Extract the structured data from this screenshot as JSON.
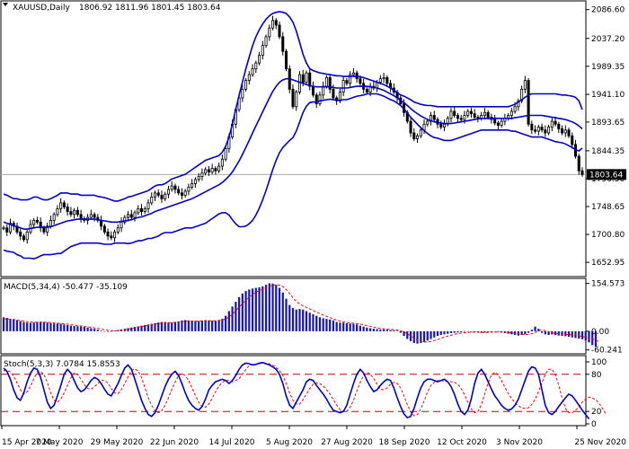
{
  "chart_data": [
    {
      "type": "candlestick",
      "symbol": "XAUUSD,Daily",
      "ohlc_label": "1806.92 1811.96 1801.45 1803.64",
      "current_price": 1803.64,
      "current_price_label": "1803.64",
      "ylim": [
        1630,
        2100
      ],
      "y_ticks": [
        "2086.60",
        "2037.20",
        "1989.35",
        "1941.10",
        "1893.65",
        "1844.35",
        "1796.50",
        "1748.65",
        "1700.80",
        "1652.95"
      ],
      "close_series": [
        1712,
        1705,
        1720,
        1715,
        1705,
        1698,
        1692,
        1705,
        1718,
        1725,
        1722,
        1712,
        1705,
        1715,
        1725,
        1735,
        1745,
        1755,
        1748,
        1740,
        1735,
        1742,
        1735,
        1728,
        1725,
        1730,
        1735,
        1730,
        1725,
        1715,
        1705,
        1698,
        1695,
        1705,
        1712,
        1722,
        1730,
        1735,
        1730,
        1738,
        1745,
        1740,
        1745,
        1755,
        1765,
        1772,
        1768,
        1762,
        1770,
        1778,
        1784,
        1778,
        1772,
        1768,
        1775,
        1782,
        1788,
        1795,
        1800,
        1806,
        1812,
        1808,
        1814,
        1810,
        1818,
        1830,
        1848,
        1868,
        1890,
        1915,
        1935,
        1950,
        1965,
        1975,
        1985,
        1995,
        2008,
        2025,
        2040,
        2055,
        2068,
        2060,
        2040,
        2015,
        1985,
        1950,
        1920,
        1945,
        1975,
        1962,
        1978,
        1955,
        1940,
        1925,
        1940,
        1955,
        1970,
        1950,
        1935,
        1930,
        1945,
        1965,
        1960,
        1975,
        1978,
        1968,
        1960,
        1950,
        1945,
        1955,
        1952,
        1962,
        1968,
        1970,
        1960,
        1952,
        1945,
        1935,
        1925,
        1910,
        1895,
        1875,
        1865,
        1870,
        1880,
        1890,
        1895,
        1905,
        1898,
        1890,
        1885,
        1890,
        1900,
        1912,
        1905,
        1900,
        1898,
        1905,
        1912,
        1908,
        1902,
        1900,
        1905,
        1910,
        1902,
        1898,
        1892,
        1888,
        1895,
        1900,
        1905,
        1912,
        1920,
        1930,
        1950,
        1965,
        1890,
        1880,
        1878,
        1885,
        1880,
        1875,
        1885,
        1895,
        1890,
        1882,
        1875,
        1880,
        1870,
        1855,
        1835,
        1810,
        1803.64
      ],
      "bollinger_upper": [
        1770,
        1768,
        1765,
        1762,
        1762,
        1760,
        1760,
        1760,
        1762,
        1765,
        1765,
        1762,
        1760,
        1760,
        1762,
        1765,
        1768,
        1772,
        1772,
        1772,
        1770,
        1770,
        1770,
        1768,
        1768,
        1768,
        1768,
        1768,
        1766,
        1765,
        1764,
        1762,
        1760,
        1758,
        1758,
        1760,
        1762,
        1765,
        1766,
        1768,
        1770,
        1772,
        1774,
        1776,
        1780,
        1784,
        1786,
        1786,
        1788,
        1792,
        1796,
        1798,
        1800,
        1802,
        1804,
        1808,
        1812,
        1816,
        1820,
        1824,
        1828,
        1830,
        1832,
        1834,
        1836,
        1842,
        1852,
        1868,
        1890,
        1915,
        1940,
        1962,
        1985,
        2005,
        2025,
        2040,
        2052,
        2062,
        2070,
        2076,
        2080,
        2082,
        2083,
        2082,
        2080,
        2074,
        2065,
        2050,
        2030,
        2010,
        1995,
        1985,
        1982,
        1980,
        1978,
        1977,
        1976,
        1975,
        1974,
        1973,
        1973,
        1972,
        1972,
        1972,
        1972,
        1972,
        1971,
        1970,
        1968,
        1966,
        1964,
        1962,
        1960,
        1958,
        1955,
        1952,
        1948,
        1944,
        1940,
        1938,
        1935,
        1932,
        1928,
        1926,
        1924,
        1923,
        1922,
        1922,
        1921,
        1920,
        1920,
        1920,
        1920,
        1920,
        1920,
        1920,
        1920,
        1920,
        1920,
        1920,
        1920,
        1920,
        1920,
        1920,
        1920,
        1920,
        1920,
        1920,
        1920,
        1920,
        1920,
        1922,
        1924,
        1928,
        1932,
        1936,
        1940,
        1942,
        1942,
        1942,
        1942,
        1942,
        1942,
        1942,
        1942,
        1941,
        1940,
        1940,
        1939,
        1938,
        1936,
        1930,
        1915
      ],
      "bollinger_middle": [
        1722,
        1720,
        1718,
        1716,
        1714,
        1712,
        1710,
        1710,
        1711,
        1712,
        1713,
        1713,
        1713,
        1713,
        1714,
        1716,
        1718,
        1720,
        1722,
        1724,
        1725,
        1726,
        1727,
        1727,
        1727,
        1727,
        1727,
        1727,
        1726,
        1725,
        1724,
        1723,
        1722,
        1722,
        1722,
        1723,
        1724,
        1725,
        1726,
        1728,
        1730,
        1731,
        1733,
        1735,
        1737,
        1740,
        1742,
        1744,
        1746,
        1748,
        1750,
        1752,
        1754,
        1756,
        1758,
        1760,
        1762,
        1765,
        1768,
        1771,
        1774,
        1777,
        1780,
        1783,
        1786,
        1790,
        1795,
        1801,
        1808,
        1817,
        1827,
        1838,
        1850,
        1862,
        1875,
        1887,
        1899,
        1911,
        1923,
        1935,
        1946,
        1955,
        1962,
        1966,
        1968,
        1968,
        1966,
        1964,
        1962,
        1960,
        1958,
        1956,
        1955,
        1954,
        1954,
        1954,
        1954,
        1954,
        1953,
        1952,
        1952,
        1952,
        1952,
        1953,
        1954,
        1955,
        1955,
        1955,
        1955,
        1954,
        1953,
        1952,
        1950,
        1948,
        1945,
        1942,
        1939,
        1935,
        1931,
        1927,
        1922,
        1917,
        1912,
        1908,
        1904,
        1901,
        1898,
        1896,
        1894,
        1893,
        1892,
        1891,
        1891,
        1891,
        1892,
        1893,
        1894,
        1895,
        1896,
        1897,
        1898,
        1899,
        1900,
        1900,
        1900,
        1900,
        1900,
        1900,
        1900,
        1900,
        1900,
        1900,
        1901,
        1902,
        1903,
        1904,
        1905,
        1905,
        1905,
        1905,
        1905,
        1904,
        1903,
        1902,
        1901,
        1900,
        1899,
        1898,
        1896,
        1894,
        1891,
        1887,
        1882
      ],
      "bollinger_lower": [
        1674,
        1672,
        1671,
        1670,
        1666,
        1664,
        1660,
        1660,
        1660,
        1659,
        1661,
        1664,
        1666,
        1666,
        1666,
        1667,
        1668,
        1668,
        1672,
        1676,
        1680,
        1682,
        1684,
        1686,
        1686,
        1686,
        1686,
        1686,
        1686,
        1685,
        1684,
        1684,
        1684,
        1686,
        1686,
        1686,
        1686,
        1685,
        1686,
        1688,
        1690,
        1690,
        1692,
        1694,
        1694,
        1696,
        1698,
        1702,
        1704,
        1704,
        1704,
        1706,
        1708,
        1710,
        1712,
        1712,
        1712,
        1714,
        1716,
        1718,
        1720,
        1724,
        1728,
        1732,
        1736,
        1738,
        1738,
        1734,
        1726,
        1719,
        1714,
        1714,
        1715,
        1719,
        1725,
        1734,
        1746,
        1760,
        1776,
        1794,
        1812,
        1828,
        1841,
        1850,
        1856,
        1862,
        1867,
        1878,
        1894,
        1910,
        1921,
        1927,
        1928,
        1928,
        1930,
        1931,
        1932,
        1933,
        1932,
        1931,
        1931,
        1932,
        1932,
        1934,
        1936,
        1938,
        1939,
        1940,
        1942,
        1942,
        1942,
        1942,
        1940,
        1938,
        1935,
        1932,
        1930,
        1926,
        1922,
        1916,
        1909,
        1902,
        1896,
        1890,
        1884,
        1879,
        1874,
        1870,
        1867,
        1866,
        1864,
        1862,
        1862,
        1862,
        1864,
        1866,
        1868,
        1870,
        1872,
        1874,
        1876,
        1878,
        1880,
        1880,
        1880,
        1880,
        1880,
        1880,
        1880,
        1880,
        1880,
        1878,
        1878,
        1876,
        1874,
        1872,
        1870,
        1868,
        1868,
        1868,
        1868,
        1866,
        1864,
        1862,
        1860,
        1859,
        1858,
        1856,
        1853,
        1850,
        1846,
        1844,
        1849
      ],
      "macd_label": "MACD(5,34,4) -50.477 -35.109",
      "macd_ylim": [
        -70,
        165
      ],
      "macd_ticks": [
        "154.573",
        "0.00",
        "-60.241"
      ],
      "macd_hist": [
        45,
        43,
        40,
        38,
        36,
        33,
        30,
        28,
        27,
        28,
        30,
        31,
        30,
        28,
        26,
        25,
        25,
        24,
        22,
        20,
        18,
        17,
        16,
        15,
        14,
        12,
        10,
        8,
        5,
        2,
        0,
        -2,
        0,
        2,
        4,
        6,
        8,
        10,
        12,
        14,
        16,
        18,
        20,
        22,
        24,
        26,
        28,
        30,
        30,
        28,
        28,
        30,
        32,
        35,
        36,
        35,
        34,
        33,
        33,
        34,
        36,
        35,
        34,
        34,
        36,
        40,
        50,
        65,
        80,
        95,
        110,
        122,
        130,
        135,
        138,
        140,
        142,
        145,
        150,
        155,
        154,
        150,
        140,
        125,
        105,
        85,
        75,
        70,
        72,
        70,
        65,
        60,
        55,
        50,
        45,
        42,
        40,
        38,
        35,
        30,
        28,
        28,
        26,
        25,
        24,
        22,
        18,
        15,
        12,
        10,
        8,
        7,
        6,
        6,
        5,
        4,
        3,
        1,
        -5,
        -15,
        -25,
        -32,
        -38,
        -40,
        -38,
        -35,
        -30,
        -25,
        -20,
        -15,
        -12,
        -10,
        -8,
        -6,
        -5,
        -4,
        -3,
        -2,
        -1,
        -2,
        -3,
        -4,
        -5,
        -4,
        -3,
        -2,
        -1,
        -2,
        -4,
        -6,
        -8,
        -10,
        -12,
        -14,
        -12,
        -10,
        -5,
        5,
        15,
        8,
        -5,
        -10,
        -12,
        -10,
        -12,
        -14,
        -15,
        -16,
        -18,
        -20,
        -22,
        -24,
        -26,
        -30,
        -36,
        -45,
        -50
      ],
      "macd_signal": [
        40,
        40,
        39,
        38,
        36,
        35,
        33,
        31,
        30,
        29,
        29,
        29,
        29,
        29,
        28,
        27,
        26,
        25,
        24,
        23,
        21,
        20,
        18,
        17,
        16,
        14,
        13,
        11,
        9,
        7,
        5,
        3,
        2,
        2,
        2,
        3,
        5,
        7,
        9,
        11,
        13,
        15,
        17,
        19,
        21,
        23,
        25,
        26,
        27,
        28,
        28,
        29,
        30,
        31,
        32,
        33,
        33,
        33,
        33,
        34,
        34,
        34,
        34,
        34,
        35,
        36,
        40,
        46,
        55,
        66,
        78,
        90,
        101,
        111,
        119,
        126,
        131,
        136,
        140,
        145,
        148,
        150,
        149,
        144,
        135,
        122,
        108,
        96,
        88,
        82,
        77,
        72,
        67,
        62,
        57,
        52,
        48,
        44,
        40,
        36,
        33,
        31,
        29,
        27,
        26,
        25,
        23,
        21,
        18,
        16,
        13,
        11,
        9,
        8,
        7,
        6,
        5,
        4,
        2,
        -2,
        -8,
        -15,
        -22,
        -28,
        -33,
        -35,
        -35,
        -33,
        -30,
        -27,
        -23,
        -19,
        -16,
        -13,
        -10,
        -8,
        -6,
        -5,
        -4,
        -3,
        -3,
        -3,
        -4,
        -4,
        -4,
        -3,
        -3,
        -2,
        -2,
        -3,
        -4,
        -5,
        -7,
        -9,
        -10,
        -11,
        -10,
        -8,
        -4,
        2,
        4,
        2,
        -2,
        -5,
        -7,
        -8,
        -9,
        -10,
        -11,
        -12,
        -13,
        -15,
        -17,
        -19,
        -22,
        -25,
        -28,
        -35
      ],
      "stoch_label": "Stoch(5,3,3) 7.0784 15.8553",
      "stoch_ylim": [
        0,
        100
      ],
      "stoch_ticks": [
        "100",
        "80",
        "20",
        "0"
      ],
      "stoch_levels": [
        80,
        20
      ],
      "stoch_k": [
        90,
        85,
        72,
        55,
        42,
        38,
        50,
        68,
        82,
        90,
        88,
        75,
        55,
        35,
        25,
        30,
        45,
        62,
        80,
        88,
        82,
        70,
        58,
        52,
        55,
        62,
        70,
        75,
        72,
        65,
        56,
        48,
        45,
        55,
        65,
        78,
        90,
        95,
        88,
        72,
        55,
        38,
        25,
        15,
        12,
        18,
        30,
        45,
        60,
        72,
        80,
        85,
        78,
        65,
        50,
        38,
        30,
        25,
        22,
        28,
        40,
        55,
        62,
        68,
        70,
        72,
        70,
        65,
        70,
        78,
        88,
        95,
        98,
        97,
        95,
        96,
        98,
        99,
        97,
        95,
        92,
        88,
        80,
        65,
        45,
        30,
        25,
        35,
        45,
        55,
        68,
        72,
        70,
        62,
        55,
        48,
        40,
        30,
        22,
        20,
        18,
        20,
        30,
        48,
        65,
        80,
        88,
        82,
        70,
        60,
        52,
        55,
        62,
        68,
        72,
        70,
        58,
        42,
        28,
        16,
        10,
        12,
        25,
        42,
        58,
        68,
        72,
        72,
        70,
        68,
        70,
        72,
        68,
        60,
        48,
        32,
        20,
        15,
        22,
        40,
        65,
        82,
        88,
        80,
        68,
        56,
        45,
        38,
        30,
        25,
        22,
        24,
        30,
        40,
        55,
        70,
        85,
        92,
        90,
        80,
        55,
        30,
        18,
        15,
        20,
        28,
        35,
        42,
        48,
        45,
        38,
        30,
        22,
        15,
        8
      ],
      "stoch_d": [
        86,
        86,
        84,
        77,
        66,
        55,
        48,
        52,
        61,
        73,
        83,
        84,
        80,
        67,
        50,
        38,
        35,
        40,
        50,
        62,
        74,
        82,
        80,
        72,
        63,
        57,
        56,
        60,
        65,
        70,
        70,
        66,
        57,
        50,
        49,
        55,
        65,
        76,
        86,
        89,
        85,
        75,
        58,
        42,
        30,
        21,
        18,
        21,
        30,
        42,
        56,
        68,
        78,
        81,
        78,
        70,
        58,
        46,
        35,
        28,
        27,
        32,
        41,
        52,
        61,
        67,
        70,
        70,
        68,
        70,
        73,
        80,
        88,
        94,
        96,
        96,
        97,
        98,
        98,
        97,
        95,
        91,
        86,
        78,
        65,
        50,
        38,
        32,
        32,
        39,
        48,
        57,
        64,
        66,
        65,
        61,
        55,
        48,
        39,
        30,
        23,
        20,
        20,
        27,
        38,
        53,
        67,
        78,
        83,
        80,
        73,
        64,
        56,
        55,
        58,
        64,
        67,
        65,
        58,
        45,
        31,
        19,
        13,
        15,
        24,
        37,
        52,
        62,
        67,
        70,
        70,
        69,
        68,
        68,
        67,
        64,
        57,
        47,
        35,
        24,
        18,
        20,
        31,
        48,
        66,
        79,
        83,
        79,
        70,
        59,
        49,
        41,
        34,
        29,
        26,
        25,
        26,
        31,
        40,
        52,
        66,
        80,
        88,
        88,
        80,
        62,
        42,
        25,
        18,
        18,
        22,
        27,
        35,
        40,
        43,
        42,
        39,
        33,
        25,
        16
      ]
    }
  ],
  "x_labels": [
    "15 Apr 2020",
    "7 May 2020",
    "29 May 2020",
    "22 Jun 2020",
    "14 Jul 2020",
    "5 Aug 2020",
    "27 Aug 2020",
    "18 Sep 2020",
    "12 Oct 2020",
    "3 Nov 2020",
    "25 Nov 2020"
  ],
  "colors": {
    "candle": "#000000",
    "bands": "#0000cc",
    "macd_hist": "#1a1aaa",
    "macd_signal": "#ff0000",
    "stoch_k": "#0000cc",
    "stoch_d": "#ff0000",
    "level": "#cc0000",
    "price_box": "#000000"
  }
}
